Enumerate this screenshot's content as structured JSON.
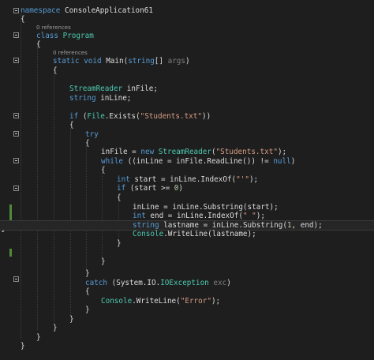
{
  "codelens": {
    "program": "0 references",
    "main": "0 references"
  },
  "lines": [
    "namespace ConsoleApplication61",
    "{",
    "class Program",
    "{",
    "static void Main(string[] args)",
    "{",
    "",
    "StreamReader inFile;",
    "string inLine;",
    "",
    "if (File.Exists(\"Students.txt\"))",
    "{",
    "try",
    "{",
    "inFile = new StreamReader(\"Students.txt\");",
    "while ((inLine = inFile.ReadLine()) != null)",
    "{",
    "int start = inLine.IndexOf(\"'\");",
    "if (start >= 0)",
    "{",
    "inLine = inLine.Substring(start);",
    "int end = inLine.IndexOf(\" \");",
    "string lastname = inLine.Substring(1, end);",
    "Console.WriteLine(lastname);",
    "}",
    "",
    "}",
    "",
    "}",
    "catch (System.IO.IOException exc)",
    "{",
    "Console.WriteLine(\"Error\");",
    "}",
    "}",
    "}",
    "}",
    "}"
  ]
}
